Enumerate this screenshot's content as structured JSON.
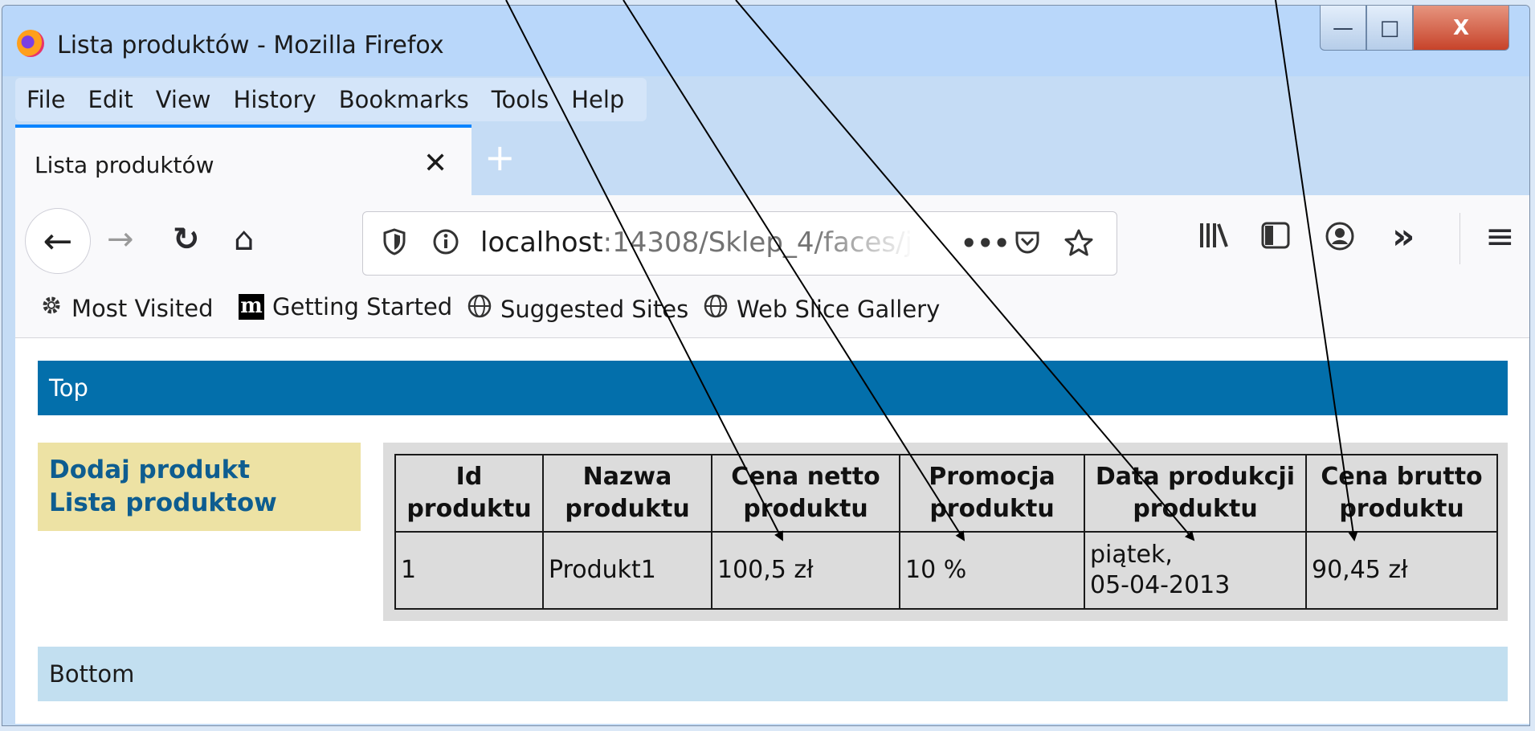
{
  "window": {
    "title": "Lista produktów - Mozilla Firefox",
    "controls": {
      "minimize": "—",
      "maximize": "□",
      "close": "X"
    }
  },
  "menubar": [
    {
      "label": "File"
    },
    {
      "label": "Edit"
    },
    {
      "label": "View"
    },
    {
      "label": "History"
    },
    {
      "label": "Bookmarks"
    },
    {
      "label": "Tools"
    },
    {
      "label": "Help"
    }
  ],
  "tab": {
    "title": "Lista produktów",
    "close": "✕",
    "new_tab": "+"
  },
  "nav": {
    "back": "←",
    "forward": "→",
    "reload": "↻",
    "home": "⌂",
    "url_host": "localhost",
    "url_path": ":14308/Sklep_4/faces/j",
    "page_actions": "•••",
    "pocket": "♡",
    "bookmark_star": "☆",
    "library": "|||\\",
    "sidebar": "▯",
    "account": "◉",
    "overflow": "»",
    "menu": "≡"
  },
  "bookmarks": [
    {
      "label": "Most Visited",
      "icon": "gear-icon"
    },
    {
      "label": "Getting Started",
      "icon": "m-icon"
    },
    {
      "label": "Suggested Sites",
      "icon": "globe-icon"
    },
    {
      "label": "Web Slice Gallery",
      "icon": "globe-icon"
    }
  ],
  "page": {
    "top_banner": "Top",
    "left_menu": [
      "Dodaj produkt",
      "Lista produktow"
    ],
    "table": {
      "headers": [
        [
          "Id",
          "produktu"
        ],
        [
          "Nazwa",
          "produktu"
        ],
        [
          "Cena netto",
          "produktu"
        ],
        [
          "Promocja",
          "produktu"
        ],
        [
          "Data produkcji",
          "produktu"
        ],
        [
          "Cena brutto",
          "produktu"
        ]
      ],
      "rows": [
        [
          "1",
          "Produkt1",
          "100,5 zł",
          "10 %",
          "piątek,",
          "05-04-2013",
          "90,45 zł"
        ]
      ]
    },
    "bottom_banner": "Bottom"
  },
  "colors": {
    "top_banner": "#036fab",
    "left_menu_bg": "#ede2a4",
    "link": "#0e5d90",
    "bottom_banner": "#c2dff0",
    "table_bg": "#dcdcdc"
  }
}
